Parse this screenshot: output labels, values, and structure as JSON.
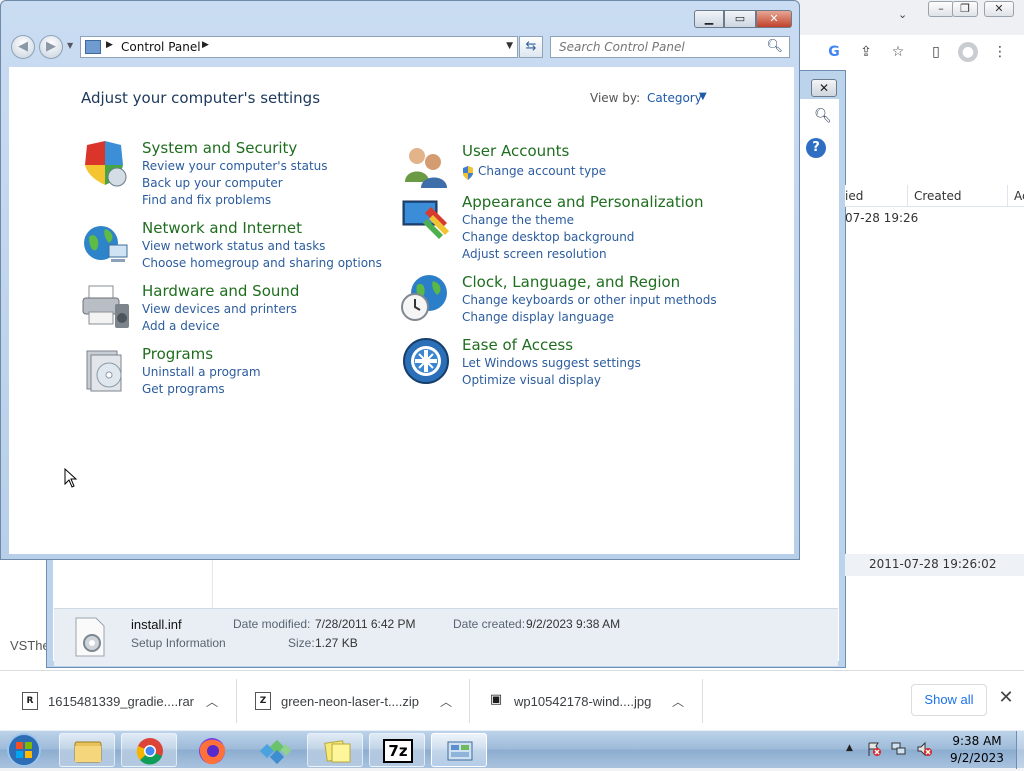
{
  "control_panel": {
    "address": "Control Panel",
    "search_placeholder": "Search Control Panel",
    "heading": "Adjust your computer's settings",
    "view_by_label": "View by:",
    "view_by_value": "Category",
    "categories_left": [
      {
        "title": "System and Security",
        "links": [
          "Review your computer's status",
          "Back up your computer",
          "Find and fix problems"
        ]
      },
      {
        "title": "Network and Internet",
        "links": [
          "View network status and tasks",
          "Choose homegroup and sharing options"
        ]
      },
      {
        "title": "Hardware and Sound",
        "links": [
          "View devices and printers",
          "Add a device"
        ]
      },
      {
        "title": "Programs",
        "links": [
          "Uninstall a program",
          "Get programs"
        ]
      }
    ],
    "categories_right": [
      {
        "title": "User Accounts",
        "links": [
          "Change account type"
        ]
      },
      {
        "title": "Appearance and Personalization",
        "links": [
          "Change the theme",
          "Change desktop background",
          "Adjust screen resolution"
        ]
      },
      {
        "title": "Clock, Language, and Region",
        "links": [
          "Change keyboards or other input methods",
          "Change display language"
        ]
      },
      {
        "title": "Ease of Access",
        "links": [
          "Let Windows suggest settings",
          "Optimize visual display"
        ]
      }
    ]
  },
  "explorer": {
    "columns": [
      "ied",
      "Created",
      "Ac"
    ],
    "row_modified": "07-28 19:26",
    "status_row": "2011-07-28 19:26:02",
    "details": {
      "file_name": "install.inf",
      "file_type": "Setup Information",
      "date_modified_label": "Date modified:",
      "date_modified": "7/28/2011 6:42 PM",
      "size_label": "Size:",
      "size": "1.27 KB",
      "date_created_label": "Date created:",
      "date_created": "9/2/2023 9:38 AM"
    }
  },
  "browser": {
    "partial_text": "VSThe",
    "downloads": [
      {
        "name": "1615481339_gradie....rar",
        "icon_letter": "R"
      },
      {
        "name": "green-neon-laser-t....zip",
        "icon_letter": "Z"
      },
      {
        "name": "wp10542178-wind....jpg",
        "icon_letter": "▣"
      }
    ],
    "show_all": "Show all",
    "google_letter": "G"
  },
  "taskbar": {
    "time": "9:38 AM",
    "date": "9/2/2023",
    "sevenzip_label": "7z"
  },
  "colors": {
    "category_title": "#1f6e1f",
    "task_link": "#2c5c9e",
    "heading": "#1e395b"
  }
}
